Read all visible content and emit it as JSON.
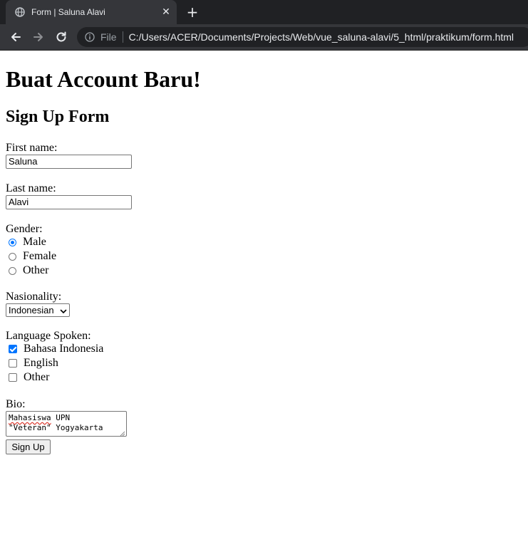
{
  "browser": {
    "tab_title": "Form | Saluna Alavi",
    "close_glyph": "✕",
    "newtab_glyph": "+",
    "file_label": "File",
    "url": "C:/Users/ACER/Documents/Projects/Web/vue_saluna-alavi/5_html/praktikum/form.html"
  },
  "page": {
    "heading": "Buat Account Baru!",
    "subheading": "Sign Up Form",
    "first_name": {
      "label": "First name:",
      "value": "Saluna"
    },
    "last_name": {
      "label": "Last name:",
      "value": "Alavi"
    },
    "gender": {
      "label": "Gender:",
      "options": [
        "Male",
        "Female",
        "Other"
      ],
      "selected": "Male"
    },
    "nationality": {
      "label": "Nasionality:",
      "selected": "Indonesian"
    },
    "languages": {
      "label": "Language Spoken:",
      "options": [
        "Bahasa Indonesia",
        "English",
        "Other"
      ],
      "checked": [
        "Bahasa Indonesia"
      ]
    },
    "bio": {
      "label": "Bio:",
      "value_first_word": "Mahasiswa",
      "value_rest": " UPN\n\"Veteran\" Yogyakarta"
    },
    "submit_label": "Sign Up"
  },
  "colors": {
    "accent": "#0075ff",
    "chrome_dark": "#202124",
    "chrome_tab": "#35363a"
  }
}
